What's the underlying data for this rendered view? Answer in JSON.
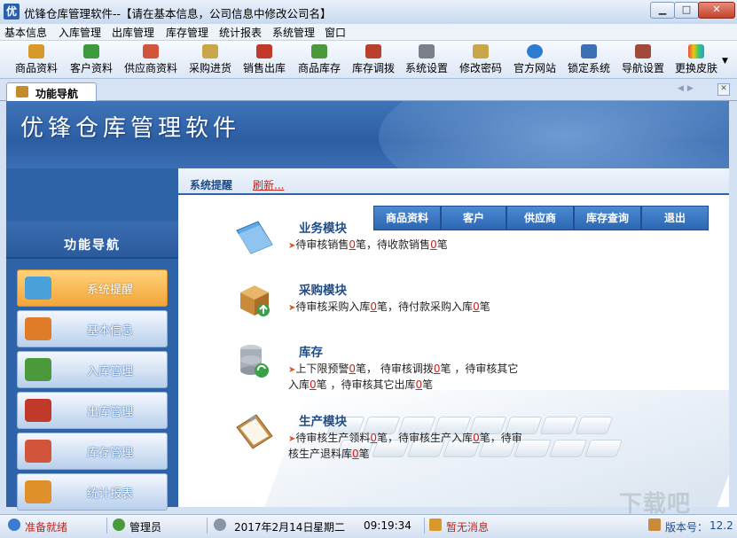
{
  "window": {
    "app_icon_char": "优",
    "title": "优锋仓库管理软件--【请在基本信息，公司信息中修改公司名】",
    "min_glyph": "▁",
    "max_glyph": "□",
    "close_glyph": "✕"
  },
  "menu": [
    "基本信息",
    "入库管理",
    "出库管理",
    "库存管理",
    "统计报表",
    "系统管理",
    "窗口"
  ],
  "toolbar": [
    {
      "label": "商品资料",
      "icon": "goods-icon",
      "color": "#d79a2a"
    },
    {
      "label": "客户资料",
      "icon": "customers-icon",
      "color": "#3b9a3b"
    },
    {
      "label": "供应商资料",
      "icon": "suppliers-icon",
      "color": "#d0553a"
    },
    {
      "label": "采购进货",
      "icon": "purchase-icon",
      "color": "#c9a64a"
    },
    {
      "label": "销售出库",
      "icon": "sales-icon",
      "color": "#c0392b"
    },
    {
      "label": "商品库存",
      "icon": "stock-icon",
      "color": "#4a9a3b"
    },
    {
      "label": "库存调拨",
      "icon": "transfer-icon",
      "color": "#b8402d"
    },
    {
      "label": "系统设置",
      "icon": "settings-icon",
      "color": "#7a7f8a"
    },
    {
      "label": "修改密码",
      "icon": "password-icon",
      "color": "#c9a64a"
    },
    {
      "label": "官方网站",
      "icon": "website-icon",
      "color": "#2d7cd3"
    },
    {
      "label": "锁定系统",
      "icon": "lock-icon",
      "color": "#3d6fb5"
    },
    {
      "label": "导航设置",
      "icon": "nav-settings-icon",
      "color": "#a04a3a"
    },
    {
      "label": "更换皮肤",
      "icon": "skin-icon",
      "color": "#8e44ad"
    }
  ],
  "tab": {
    "label": "功能导航"
  },
  "banner": {
    "title": "优锋仓库管理软件"
  },
  "leftnav": {
    "title": "功能导航",
    "items": [
      {
        "label": "系统提醒",
        "icon": "reminder-icon",
        "active": true,
        "color": "#4aa0d8"
      },
      {
        "label": "基本信息",
        "icon": "basic-info-icon",
        "active": false,
        "color": "#e07b2a"
      },
      {
        "label": "入库管理",
        "icon": "cart-in-icon",
        "active": false,
        "color": "#4a9a3b"
      },
      {
        "label": "出库管理",
        "icon": "cart-out-icon",
        "active": false,
        "color": "#c0392b"
      },
      {
        "label": "库存管理",
        "icon": "warehouse-icon",
        "active": false,
        "color": "#d0553a"
      },
      {
        "label": "统计报表",
        "icon": "report-icon",
        "active": false,
        "color": "#e0902a"
      }
    ]
  },
  "content": {
    "hint_label": "系统提醒",
    "refresh_label": "刷新...",
    "quick_buttons": [
      "商品资料",
      "客户",
      "供应商",
      "库存查询",
      "退出"
    ],
    "modules": {
      "business": {
        "title": "业务模块",
        "l1": [
          "待审核销售",
          "0",
          "笔，待收款销售",
          "0",
          "笔"
        ]
      },
      "purchase": {
        "title": "采购模块",
        "l1": [
          "待审核采购入库",
          "0",
          "笔，待付款采购入库",
          "0",
          "笔"
        ]
      },
      "inventory": {
        "title": "库存",
        "l1": [
          "上下限预警",
          "0",
          "笔，  待审核调拨",
          "0",
          "笔 ，待审核其它"
        ],
        "l2": [
          "入库",
          "0",
          "笔 ，待审核其它出库",
          "0",
          "笔"
        ]
      },
      "production": {
        "title": "生产模块",
        "l1": [
          "待审核生产领料",
          "0",
          "笔，待审核生产入库",
          "0",
          "笔，待审"
        ],
        "l2": [
          "核生产退料库",
          "0",
          "笔"
        ]
      }
    }
  },
  "status": {
    "ready": "准备就绪",
    "user": "管理员",
    "date": "2017年2月14日",
    "weekday": "星期二",
    "time": "09:19:34",
    "messages": "暂无消息",
    "version_label": "版本号：",
    "version": "12.2"
  },
  "watermark": "下载吧"
}
